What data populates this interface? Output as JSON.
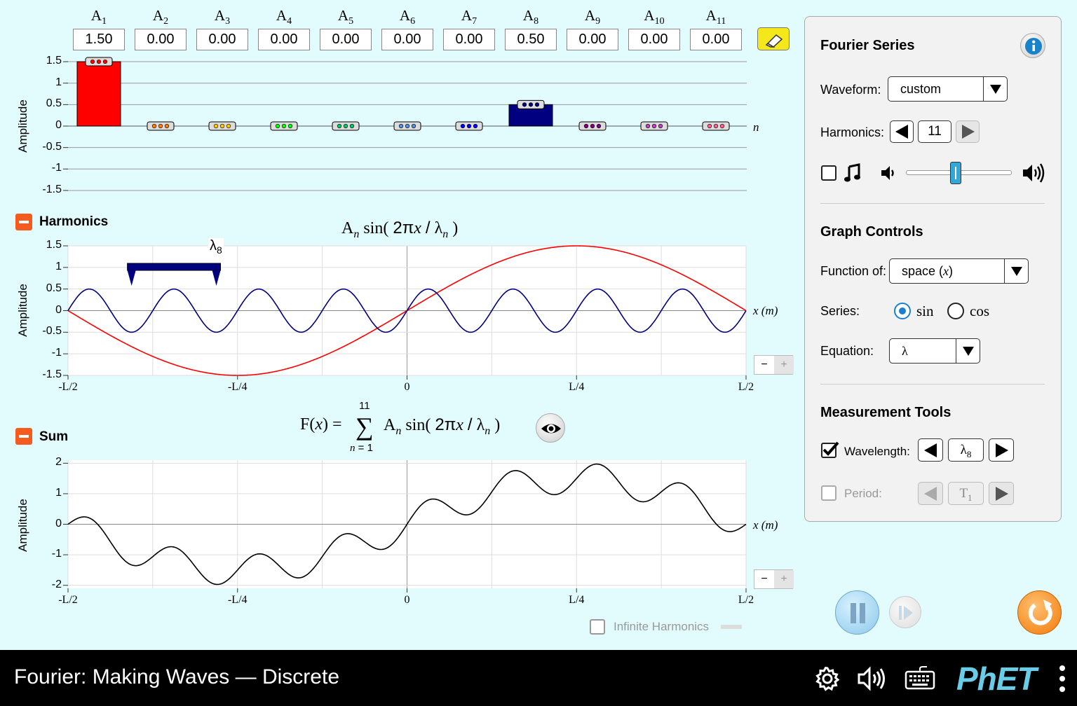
{
  "amplitudes": {
    "labels": [
      {
        "base": "A",
        "sub": "1"
      },
      {
        "base": "A",
        "sub": "2"
      },
      {
        "base": "A",
        "sub": "3"
      },
      {
        "base": "A",
        "sub": "4"
      },
      {
        "base": "A",
        "sub": "5"
      },
      {
        "base": "A",
        "sub": "6"
      },
      {
        "base": "A",
        "sub": "7"
      },
      {
        "base": "A",
        "sub": "8"
      },
      {
        "base": "A",
        "sub": "9"
      },
      {
        "base": "A",
        "sub": "10"
      },
      {
        "base": "A",
        "sub": "11"
      }
    ],
    "values": [
      "1.50",
      "0.00",
      "0.00",
      "0.00",
      "0.00",
      "0.00",
      "0.00",
      "0.50",
      "0.00",
      "0.00",
      "0.00"
    ],
    "y_ticks": [
      "1.5",
      "1",
      "0.5",
      "0",
      "-0.5",
      "-1",
      "-1.5"
    ],
    "y_axis_label": "Amplitude",
    "x_axis_label": "n",
    "bar_colors": [
      "#ff0000",
      "#ff8000",
      "#ffc800",
      "#00ff00",
      "#00c864",
      "#5090e0",
      "#0000ff",
      "#000080",
      "#800080",
      "#c040c0",
      "#ff6090"
    ]
  },
  "harmonics": {
    "title": "Harmonics",
    "formula": {
      "A": "A",
      "n": "n",
      "sin": "sin(",
      "num": "2π",
      "x": "x",
      "lambda": "λ",
      "close": ")"
    },
    "y_ticks": [
      "1.5",
      "1",
      "0.5",
      "0",
      "-0.5",
      "-1",
      "-1.5"
    ],
    "x_ticks": [
      "-L/2",
      "-L/4",
      "0",
      "L/4",
      "L/2"
    ],
    "y_axis_label": "Amplitude",
    "x_axis_label": "x (m)",
    "wavelength_label": {
      "base": "λ",
      "sub": "8"
    },
    "zoom_minus": "−",
    "zoom_plus": "+"
  },
  "sum": {
    "title": "Sum",
    "formula": {
      "F": "F(",
      "x": "x",
      "eq": ") =",
      "sigma": "∑",
      "upper": "11",
      "lower_n": "n",
      "lower_eq": " = 1",
      "A": "A",
      "n": "n",
      "sin": "sin(",
      "num": "2π",
      "lambda": "λ",
      "close": ")"
    },
    "y_ticks": [
      "2",
      "1",
      "0",
      "-1",
      "-2"
    ],
    "x_ticks": [
      "-L/2",
      "-L/4",
      "0",
      "L/4",
      "L/2"
    ],
    "y_axis_label": "Amplitude",
    "x_axis_label": "x (m)",
    "infinite_harmonics_label": "Infinite Harmonics",
    "zoom_minus": "−",
    "zoom_plus": "+"
  },
  "control_panel": {
    "fourier_title": "Fourier Series",
    "waveform_label": "Waveform:",
    "waveform_value": "custom",
    "harmonics_label": "Harmonics:",
    "harmonics_value": "11",
    "sound_enabled": false,
    "volume_fraction": 0.47,
    "graph_controls_title": "Graph Controls",
    "function_of_label": "Function of:",
    "function_of_value": "space (",
    "function_of_var": "x",
    "function_of_close": ")",
    "series_label": "Series:",
    "series_sin": "sin",
    "series_cos": "cos",
    "series_selected": "sin",
    "equation_label": "Equation:",
    "equation_value": "λ",
    "measurement_title": "Measurement Tools",
    "wavelength_label": "Wavelength:",
    "wavelength_checked": true,
    "wavelength_value": {
      "base": "λ",
      "sub": "8"
    },
    "period_label": "Period:",
    "period_checked": false,
    "period_value": {
      "base": "T",
      "sub": "1"
    }
  },
  "navbar": {
    "title": "Fourier: Making Waves — Discrete",
    "logo": "PhET"
  }
}
